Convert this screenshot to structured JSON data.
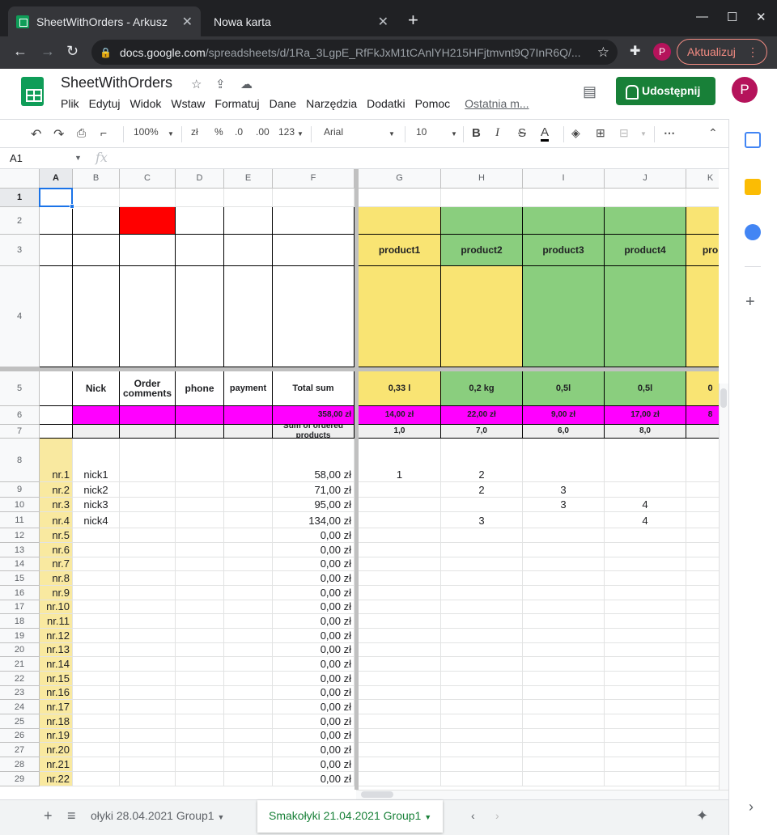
{
  "browser": {
    "tab1_title": "SheetWithOrders - Arkusz",
    "tab2_title": "Nowa karta",
    "close": "✕",
    "new_tab": "+",
    "min": "—",
    "max": "☐",
    "winclose": "✕",
    "url_host": "docs.google.com",
    "url_path": "/spreadsheets/d/1Ra_3LgpE_RfFkJxM1tCAnlYH215HFjtmvnt9Q7InR6Q/...",
    "profile_letter": "P",
    "update_label": "Aktualizuj"
  },
  "docs": {
    "title": "SheetWithOrders",
    "menu": [
      "Plik",
      "Edytuj",
      "Widok",
      "Wstaw",
      "Formatuj",
      "Dane",
      "Narzędzia",
      "Dodatki",
      "Pomoc"
    ],
    "last_edit": "Ostatnia m...",
    "share_label": "Udostępnij",
    "avatar_letter": "P"
  },
  "toolbar": {
    "zoom": "100%",
    "currency": "zł",
    "percent": "%",
    "dec_less": ".0",
    "dec_more": ".00",
    "num_format": "123",
    "font": "Arial",
    "font_size": "10",
    "bold": "B",
    "italic": "I",
    "strike": "S",
    "text_color": "A"
  },
  "formula": {
    "namebox": "A1",
    "fx": "fx"
  },
  "columns": [
    {
      "id": "A",
      "w": 41
    },
    {
      "id": "B",
      "w": 58
    },
    {
      "id": "C",
      "w": 69
    },
    {
      "id": "D",
      "w": 60
    },
    {
      "id": "E",
      "w": 60
    },
    {
      "id": "F",
      "w": 101
    },
    {
      "id": "G",
      "w": 102
    },
    {
      "id": "H",
      "w": 101
    },
    {
      "id": "I",
      "w": 101
    },
    {
      "id": "J",
      "w": 101
    },
    {
      "id": "K",
      "w": 60
    }
  ],
  "row_numbers": [
    "1",
    "2",
    "3",
    "4",
    "5",
    "6",
    "7",
    "8",
    "9",
    "10",
    "11",
    "12",
    "13",
    "14",
    "15",
    "16",
    "17",
    "18",
    "19",
    "20",
    "21",
    "22",
    "23",
    "24",
    "25",
    "26",
    "27",
    "28",
    "29"
  ],
  "header_row5": {
    "B": "Nick",
    "C": "Order comments",
    "D": "phone",
    "E": "payment",
    "F": "Total sum"
  },
  "products": [
    {
      "name": "product1",
      "unit": "0,33 l",
      "price": "14,00 zł",
      "sum": "1,0",
      "color": "#f9e473"
    },
    {
      "name": "product2",
      "unit": "0,2 kg",
      "price": "22,00 zł",
      "sum": "7,0",
      "color": "#8ace7e"
    },
    {
      "name": "product3",
      "unit": "0,5l",
      "price": "9,00 zł",
      "sum": "6,0",
      "color": "#8ace7e"
    },
    {
      "name": "product4",
      "unit": "0,5l",
      "price": "17,00 zł",
      "sum": "8,0",
      "color": "#8ace7e"
    },
    {
      "name": "pro",
      "unit": "0",
      "price": "8",
      "sum": "",
      "color": "#f9e473"
    }
  ],
  "total_price": "358,00 zł",
  "sum_label": "Sum of ordered products",
  "orders": [
    {
      "nr": "nr.1",
      "nick": "nick1",
      "total": "58,00 zł",
      "q": [
        "1",
        "2",
        "",
        "",
        ""
      ]
    },
    {
      "nr": "nr.2",
      "nick": "nick2",
      "total": "71,00 zł",
      "q": [
        "",
        "2",
        "3",
        "",
        ""
      ]
    },
    {
      "nr": "nr.3",
      "nick": "nick3",
      "total": "95,00 zł",
      "q": [
        "",
        "",
        "3",
        "4",
        ""
      ]
    },
    {
      "nr": "nr.4",
      "nick": "nick4",
      "total": "134,00 zł",
      "q": [
        "",
        "3",
        "",
        "4",
        ""
      ]
    },
    {
      "nr": "nr.5",
      "nick": "",
      "total": "0,00 zł",
      "q": [
        "",
        "",
        "",
        "",
        ""
      ]
    },
    {
      "nr": "nr.6",
      "nick": "",
      "total": "0,00 zł",
      "q": [
        "",
        "",
        "",
        "",
        ""
      ]
    },
    {
      "nr": "nr.7",
      "nick": "",
      "total": "0,00 zł",
      "q": [
        "",
        "",
        "",
        "",
        ""
      ]
    },
    {
      "nr": "nr.8",
      "nick": "",
      "total": "0,00 zł",
      "q": [
        "",
        "",
        "",
        "",
        ""
      ]
    },
    {
      "nr": "nr.9",
      "nick": "",
      "total": "0,00 zł",
      "q": [
        "",
        "",
        "",
        "",
        ""
      ]
    },
    {
      "nr": "nr.10",
      "nick": "",
      "total": "0,00 zł",
      "q": [
        "",
        "",
        "",
        "",
        ""
      ]
    },
    {
      "nr": "nr.11",
      "nick": "",
      "total": "0,00 zł",
      "q": [
        "",
        "",
        "",
        "",
        ""
      ]
    },
    {
      "nr": "nr.12",
      "nick": "",
      "total": "0,00 zł",
      "q": [
        "",
        "",
        "",
        "",
        ""
      ]
    },
    {
      "nr": "nr.13",
      "nick": "",
      "total": "0,00 zł",
      "q": [
        "",
        "",
        "",
        "",
        ""
      ]
    },
    {
      "nr": "nr.14",
      "nick": "",
      "total": "0,00 zł",
      "q": [
        "",
        "",
        "",
        "",
        ""
      ]
    },
    {
      "nr": "nr.15",
      "nick": "",
      "total": "0,00 zł",
      "q": [
        "",
        "",
        "",
        "",
        ""
      ]
    },
    {
      "nr": "nr.16",
      "nick": "",
      "total": "0,00 zł",
      "q": [
        "",
        "",
        "",
        "",
        ""
      ]
    },
    {
      "nr": "nr.17",
      "nick": "",
      "total": "0,00 zł",
      "q": [
        "",
        "",
        "",
        "",
        ""
      ]
    },
    {
      "nr": "nr.18",
      "nick": "",
      "total": "0,00 zł",
      "q": [
        "",
        "",
        "",
        "",
        ""
      ]
    },
    {
      "nr": "nr.19",
      "nick": "",
      "total": "0,00 zł",
      "q": [
        "",
        "",
        "",
        "",
        ""
      ]
    },
    {
      "nr": "nr.20",
      "nick": "",
      "total": "0,00 zł",
      "q": [
        "",
        "",
        "",
        "",
        ""
      ]
    },
    {
      "nr": "nr.21",
      "nick": "",
      "total": "0,00 zł",
      "q": [
        "",
        "",
        "",
        "",
        ""
      ]
    },
    {
      "nr": "nr.22",
      "nick": "",
      "total": "0,00 zł",
      "q": [
        "",
        "",
        "",
        "",
        ""
      ]
    }
  ],
  "sheets": {
    "tab_prev": "ołyki 28.04.2021 Group1",
    "tab_active": "Smakołyki 21.04.2021 Group1",
    "add": "+",
    "list": "≡"
  },
  "colors": {
    "accent_blue": "#1a73e8",
    "sheets_green": "#0f9d58",
    "share_green": "#188038",
    "magenta": "#ff00ff",
    "red_cell": "#ff0000",
    "nr_yellow": "#f9e9a0",
    "grey_cell": "#efefef"
  }
}
